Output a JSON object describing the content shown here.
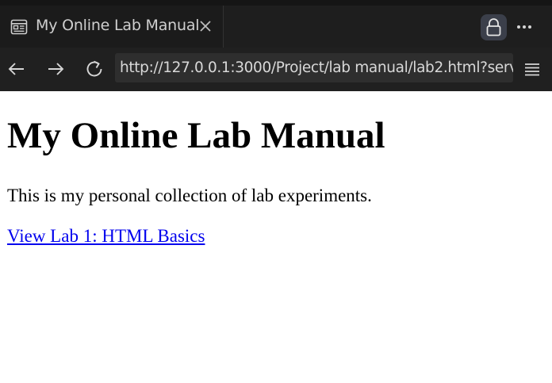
{
  "browser": {
    "tab": {
      "title": "My Online Lab Manual",
      "icon": "reader-view-icon"
    },
    "address_bar": {
      "url": "http://127.0.0.1:3000/Project/lab manual/lab2.html?serv"
    },
    "icons": {
      "close": "close-icon",
      "lock": "lock-icon",
      "more": "ellipsis-icon",
      "back": "arrow-left-icon",
      "forward": "arrow-right-icon",
      "reload": "reload-icon",
      "menu": "hamburger-menu-icon"
    },
    "colors": {
      "chrome_dark": "#1e1e1e",
      "toolbar": "#202020",
      "urlbar": "#2e2e2e",
      "lock_button": "#3b3f4a",
      "link": "#0000ee"
    }
  },
  "page": {
    "title": "My Online Lab Manual",
    "intro": "This is my personal collection of lab experiments.",
    "link_text": "View Lab 1: HTML Basics"
  }
}
